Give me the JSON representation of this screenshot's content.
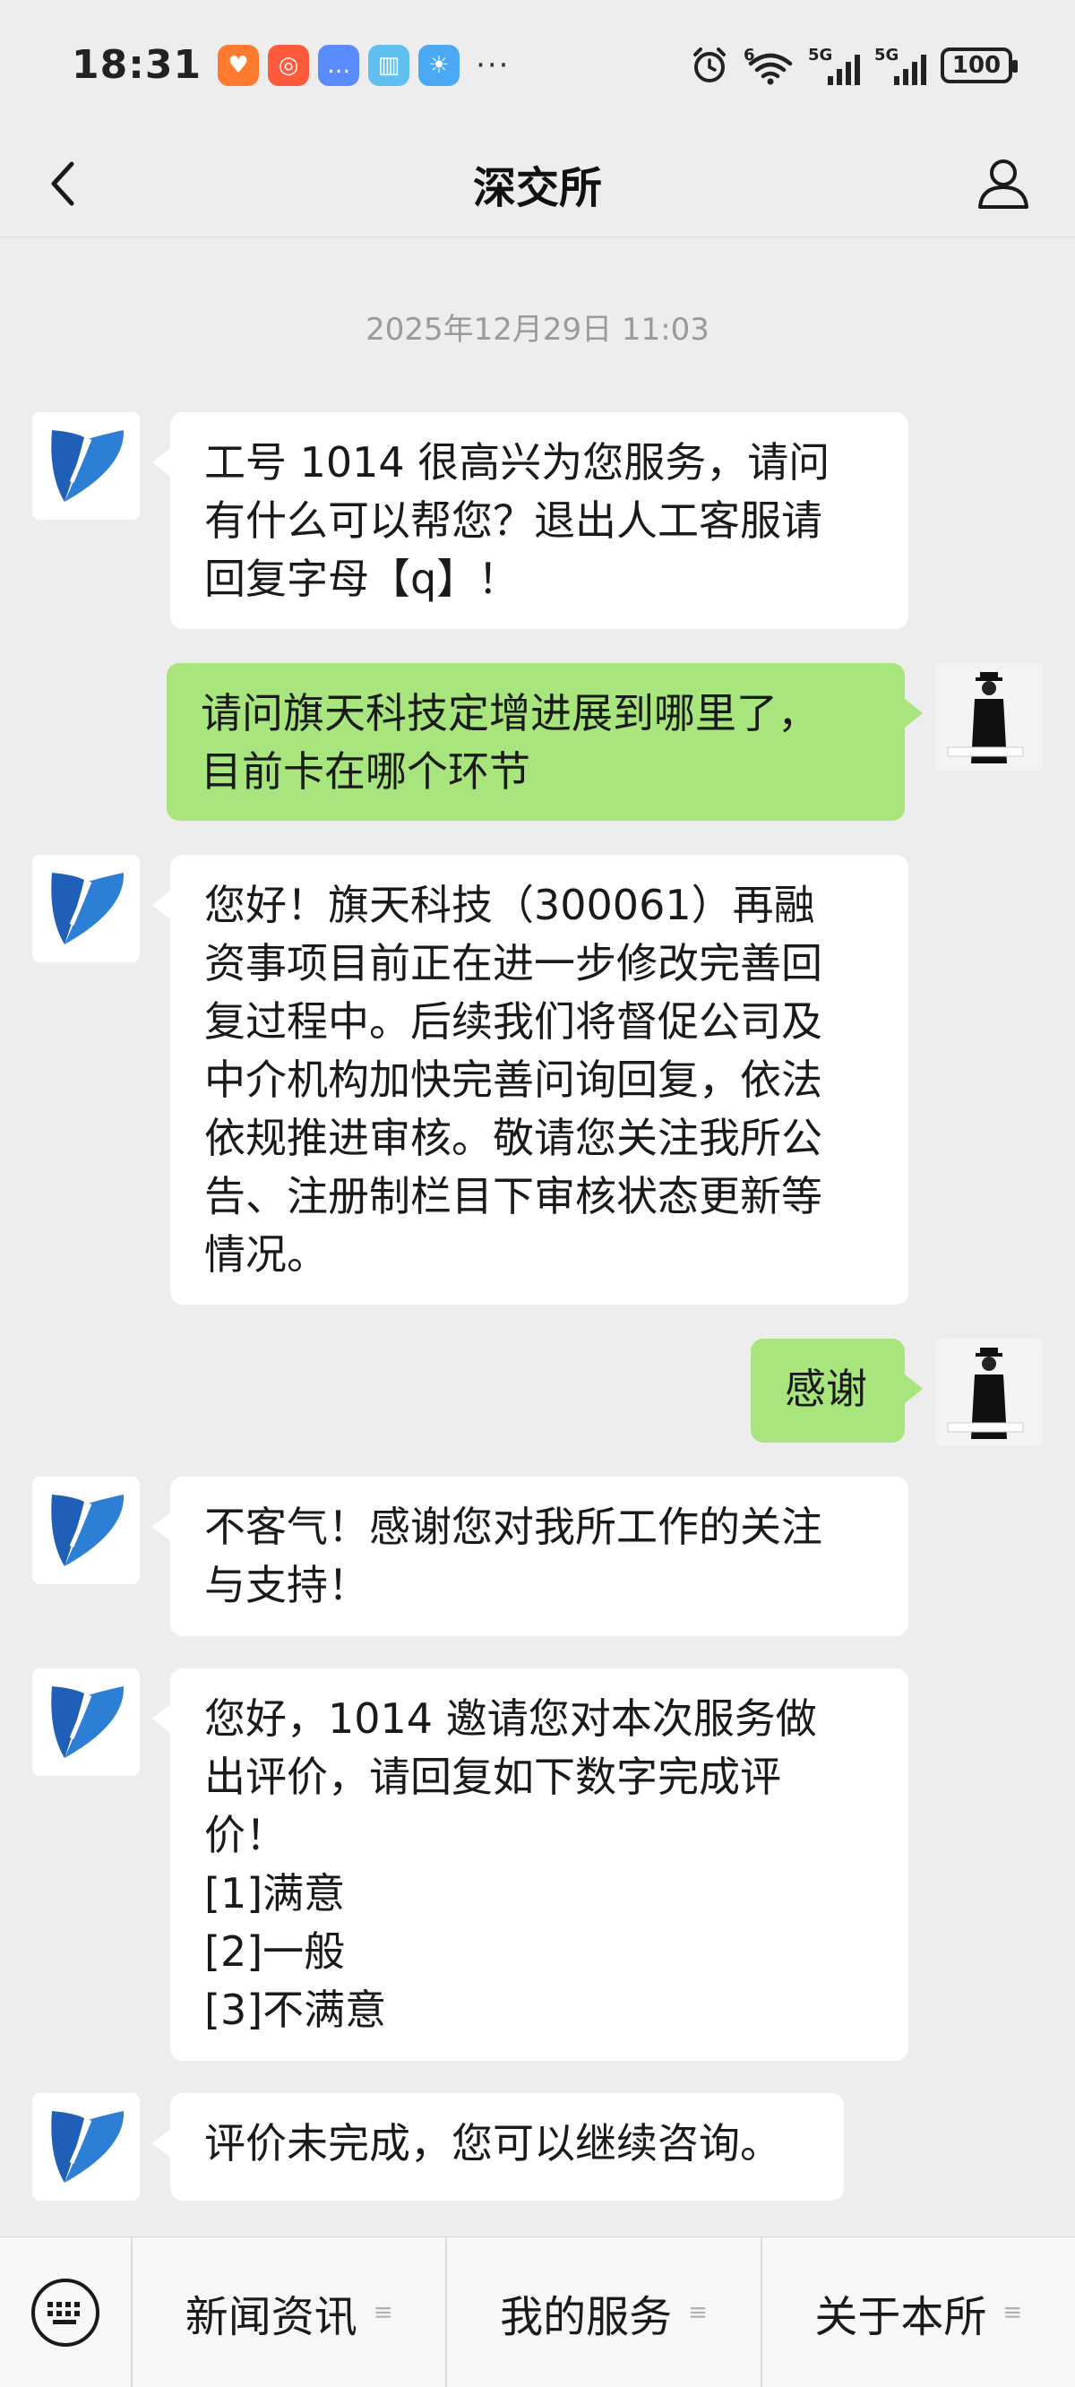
{
  "status_bar": {
    "time": "18:31",
    "notif_icons": [
      {
        "icon": "heart-app-icon",
        "color": "#ff7a2e"
      },
      {
        "icon": "video-app-icon",
        "color": "#ff5a3c"
      },
      {
        "icon": "chat-app-icon",
        "color": "#5b8cff"
      },
      {
        "icon": "book-app-icon",
        "color": "#5fc0f0"
      },
      {
        "icon": "weather-app-icon",
        "color": "#4aa8f5"
      }
    ],
    "more": "···",
    "signal1_label": "5G",
    "signal2_label": "5G",
    "wifi_label": "6",
    "battery": "100"
  },
  "nav": {
    "title": "深交所"
  },
  "chat": {
    "timestamp": "2025年12月29日 11:03",
    "messages": [
      {
        "from": "szse",
        "text": "工号 1014 很高兴为您服务，请问\n有什么可以帮您？退出人工客服请\n回复字母【q】！"
      },
      {
        "from": "user",
        "text": "请问旗天科技定增进展到哪里了，\n目前卡在哪个环节"
      },
      {
        "from": "szse",
        "text": "您好！旗天科技（300061）再融\n资事项目前正在进一步修改完善回\n复过程中。后续我们将督促公司及\n中介机构加快完善问询回复，依法\n依规推进审核。敬请您关注我所公\n告、注册制栏目下审核状态更新等\n情况。"
      },
      {
        "from": "user",
        "text": "感谢"
      },
      {
        "from": "szse",
        "text": "不客气！感谢您对我所工作的关注\n与支持！"
      },
      {
        "from": "szse",
        "text": "您好，1014 邀请您对本次服务做\n出评价，请回复如下数字完成评\n价！\n[1]满意\n[2]一般\n[3]不满意"
      },
      {
        "from": "szse",
        "text": "评价未完成，您可以继续咨询。"
      }
    ]
  },
  "bottom_menu": {
    "items": [
      {
        "label": "新闻资讯",
        "icon": "≡"
      },
      {
        "label": "我的服务",
        "icon": "≡"
      },
      {
        "label": "关于本所",
        "icon": "≡"
      }
    ]
  },
  "colors": {
    "background": "#ededed",
    "bubble_out": "#a8e57d",
    "bubble_in": "#ffffff",
    "brand_blue": "#1f5fb8"
  }
}
